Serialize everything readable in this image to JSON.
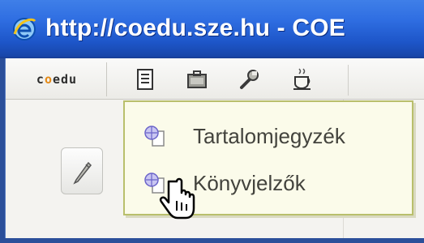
{
  "window": {
    "title": "http://coedu.sze.hu - COE",
    "app_icon": "ie-icon"
  },
  "toolbar": {
    "logo_text": "coedu",
    "tools": [
      {
        "name": "document-list-icon"
      },
      {
        "name": "briefcase-icon"
      },
      {
        "name": "wrench-icon"
      },
      {
        "name": "coffee-cup-icon"
      }
    ]
  },
  "menu": {
    "items": [
      {
        "label": "Tartalomjegyzék",
        "icon": "globe-page-icon"
      },
      {
        "label": "Könyvjelzők",
        "icon": "globe-page-icon"
      }
    ]
  },
  "colors": {
    "titlebar": "#2f6ee2",
    "menu_bg": "#fbfbea",
    "menu_border": "#b9bf6c",
    "logo_accent": "#e58a16"
  }
}
